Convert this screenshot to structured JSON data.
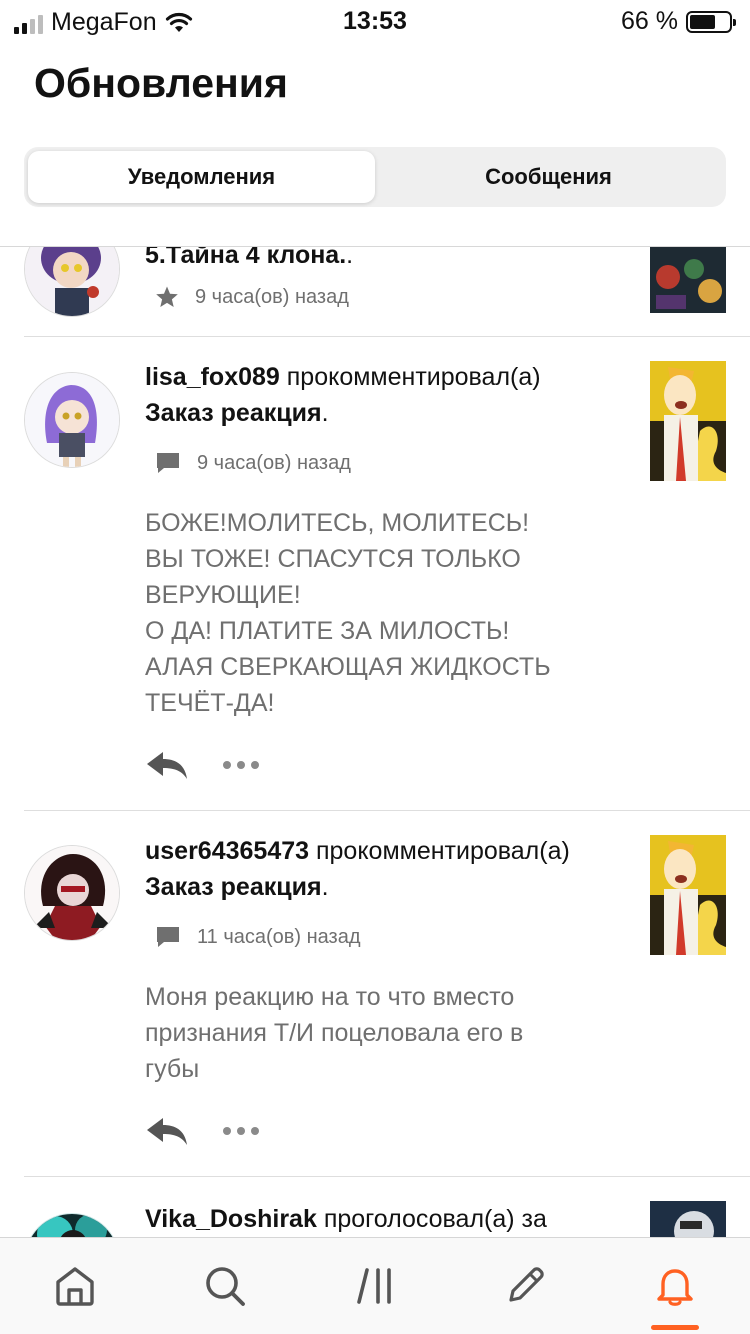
{
  "status_bar": {
    "carrier": "MegaFon",
    "time": "13:53",
    "battery_percent": "66 %",
    "battery_level": 0.66
  },
  "header": {
    "title": "Обновления",
    "tabs": [
      {
        "label": "Уведомления",
        "active": true
      },
      {
        "label": "Сообщения",
        "active": false
      }
    ]
  },
  "feed": [
    {
      "story": "5.Тайна 4 клона.",
      "story_suffix": ".",
      "time": "9 часа(ов) назад",
      "icon": "star-icon"
    },
    {
      "user": "lisa_fox089",
      "action": " прокомментировал(а)",
      "story": "Заказ реакция",
      "story_suffix": ".",
      "time": "9 часа(ов) назад",
      "icon": "comment-icon",
      "comment": "БОЖЕ!МОЛИТЕСЬ, МОЛИТЕСЬ!\nВЫ ТОЖЕ! СПАСУТСЯ ТОЛЬКО\nВЕРУЮЩИЕ!\nО ДА! ПЛАТИТЕ ЗА МИЛОСТЬ!\nАЛАЯ СВЕРКАЮЩАЯ ЖИДКОСТЬ\nТЕЧЁТ-ДА!"
    },
    {
      "user": "user64365473",
      "action": " прокомментировал(а)",
      "story": "Заказ реакция",
      "story_suffix": ".",
      "time": "11 часа(ов) назад",
      "icon": "comment-icon",
      "comment": "Моня реакцию на то что вместо\nпризнания Т/И поцеловала его в\nгубы"
    },
    {
      "user": "Vika_Doshirak",
      "action": " проголосовал(а) за"
    }
  ],
  "bottom_nav": [
    {
      "icon": "home-icon",
      "active": false
    },
    {
      "icon": "search-icon",
      "active": false
    },
    {
      "icon": "library-icon",
      "active": false
    },
    {
      "icon": "write-icon",
      "active": false
    },
    {
      "icon": "notifications-bell-icon",
      "active": true
    }
  ],
  "colors": {
    "accent": "#ff6122",
    "text_primary": "#121212",
    "text_secondary": "#6f6f6f",
    "tab_track": "#efefef"
  }
}
